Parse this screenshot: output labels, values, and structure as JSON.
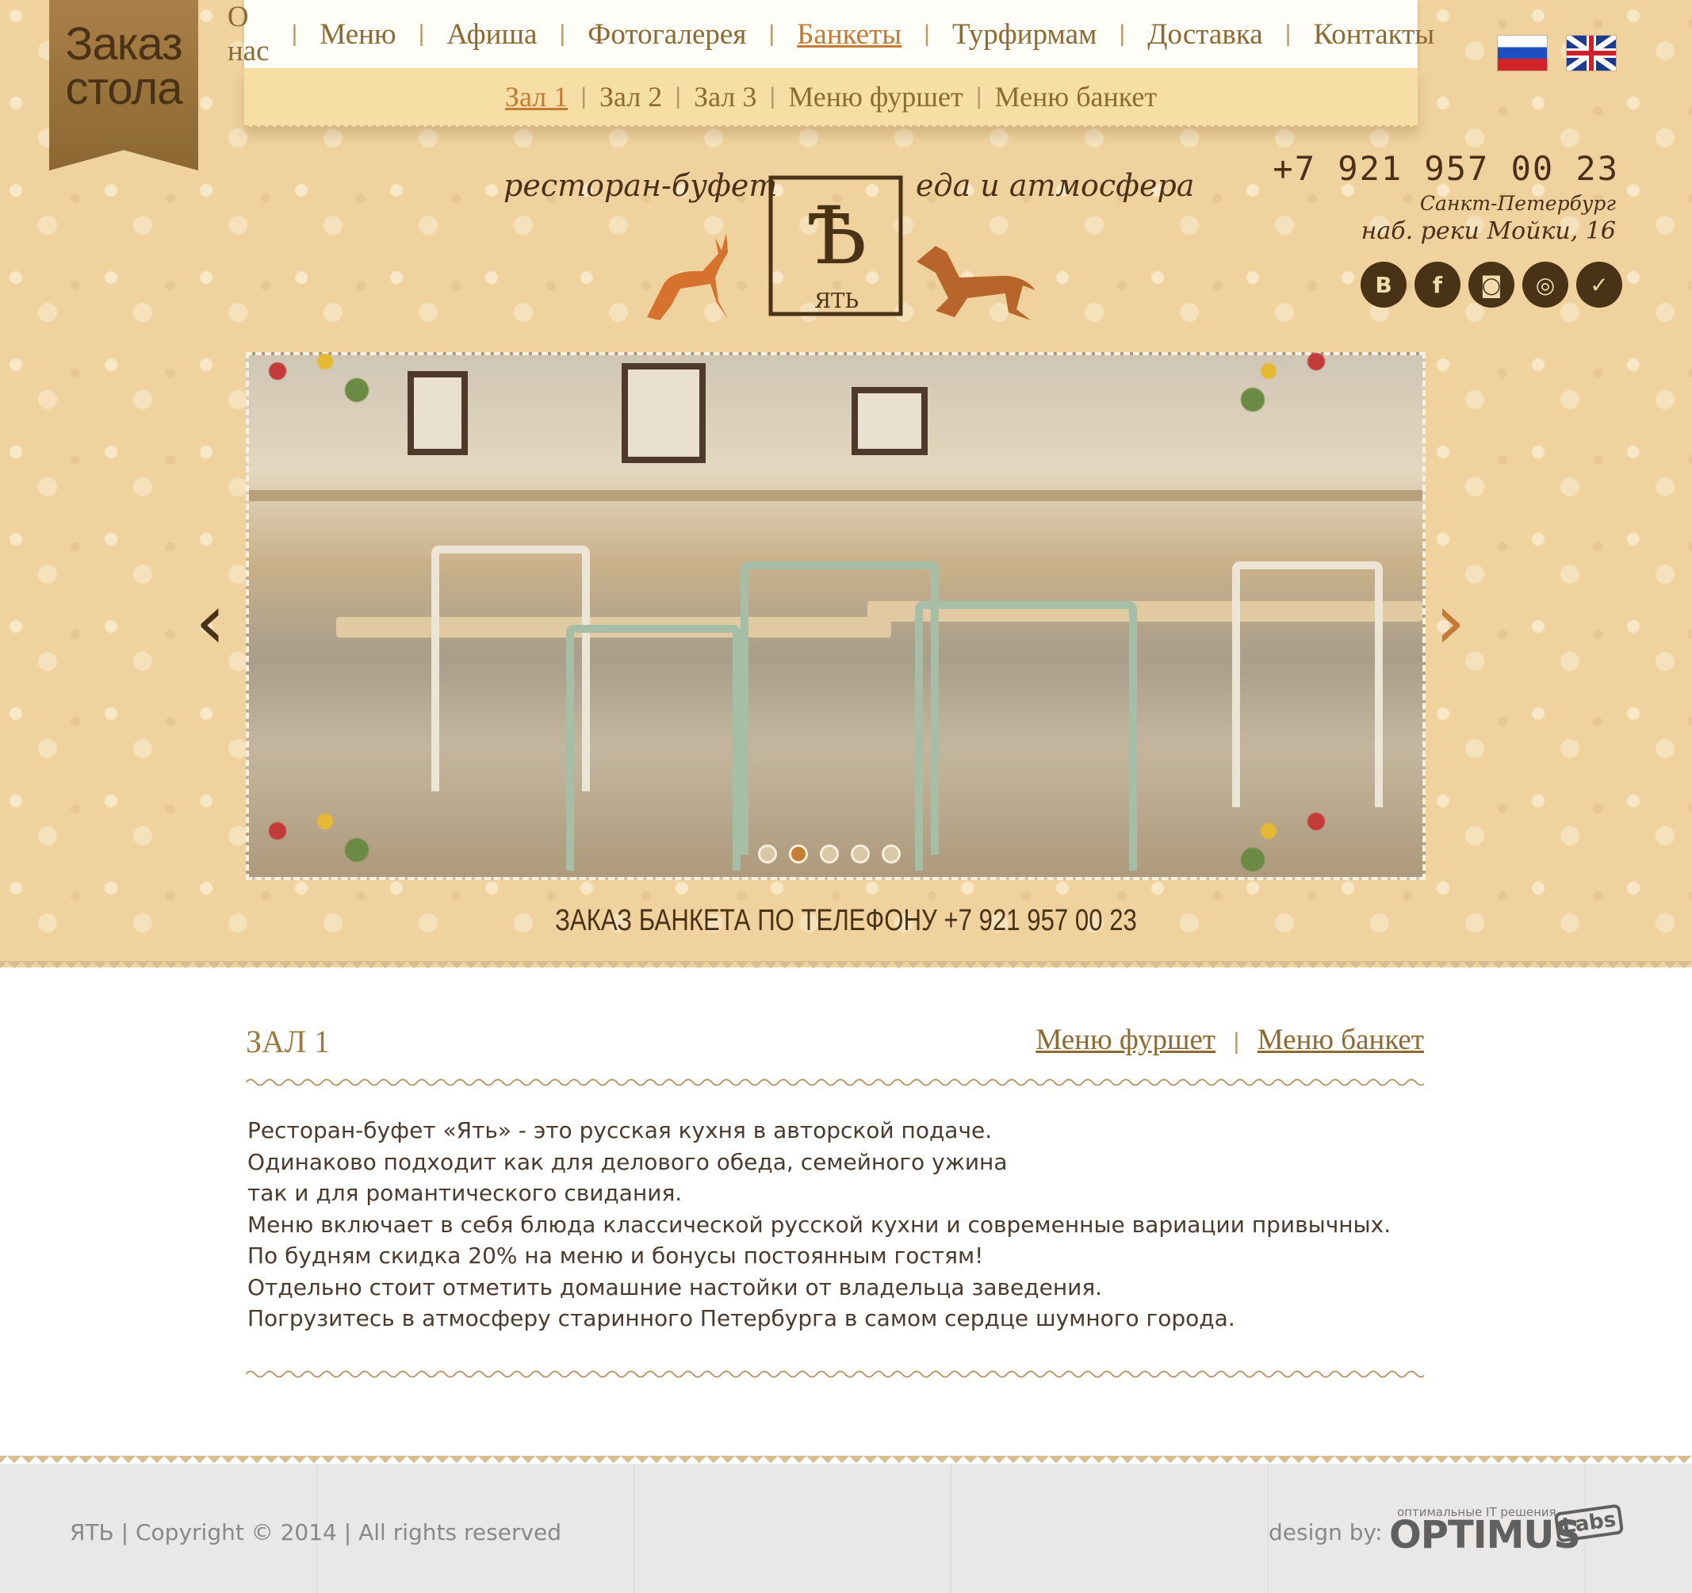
{
  "ribbon": {
    "line1": "Заказ",
    "line2": "стола"
  },
  "nav": {
    "items": [
      {
        "label": "О нас"
      },
      {
        "label": "Меню"
      },
      {
        "label": "Афиша"
      },
      {
        "label": "Фотогалерея"
      },
      {
        "label": "Банкеты",
        "active": true
      },
      {
        "label": "Турфирмам"
      },
      {
        "label": "Доставка"
      },
      {
        "label": "Контакты"
      }
    ],
    "separator": "|"
  },
  "subnav": {
    "items": [
      {
        "label": "Зал 1",
        "active": true
      },
      {
        "label": "Зал 2"
      },
      {
        "label": "Зал 3"
      },
      {
        "label": "Меню фуршет"
      },
      {
        "label": "Меню банкет"
      }
    ]
  },
  "languages": [
    "ru",
    "en"
  ],
  "brand": {
    "tagline_left": "ресторан-буфет",
    "tagline_right": "еда и атмосфера",
    "logo_letter": "Ѣ",
    "logo_name": "ЯТЬ"
  },
  "contact": {
    "phone": "+7 921 957 00 23",
    "city": "Санкт-Петербург",
    "street": "наб. реки Мойки, 16"
  },
  "socials": [
    {
      "icon": "vk-icon",
      "glyph": "В"
    },
    {
      "icon": "facebook-icon",
      "glyph": "f"
    },
    {
      "icon": "instagram-icon",
      "glyph": "◙"
    },
    {
      "icon": "tripadvisor-icon",
      "glyph": "◎"
    },
    {
      "icon": "foursquare-icon",
      "glyph": "✓"
    }
  ],
  "slider": {
    "slides": 5,
    "active_index": 1
  },
  "banquet_phone": "ЗАКАЗ БАНКЕТА ПО ТЕЛЕФОНУ +7 921 957 00 23",
  "content": {
    "title": "ЗАЛ 1",
    "links": [
      "Меню фуршет",
      "Меню банкет"
    ],
    "paragraphs": [
      "Ресторан-буфет «Ять» - это русская кухня в авторской подаче.",
      "Одинаково подходит как для делового обеда, семейного ужина",
      "так и для романтического свидания.",
      "Меню включает в себя блюда классической русской кухни и современные вариации привычных.",
      "По будням скидка 20% на меню и бонусы постоянным гостям!",
      "Отдельно стоит отметить домашние настойки от владельца заведения.",
      "Погрузитесь в атмосферу старинного Петербурга в самом сердце шумного города."
    ]
  },
  "footer": {
    "copyright": "ЯТЬ  |  Copyright  ©  2014  |  All rights reserved",
    "design_label": "design by:",
    "design_small": "оптимальные IT решения",
    "design_brand": "OPTIMUS",
    "design_labs": "Labs"
  },
  "colors": {
    "accent": "#c27a36",
    "brown": "#4a3216",
    "link": "#8c6a33",
    "header_bg": "#efd29e"
  }
}
